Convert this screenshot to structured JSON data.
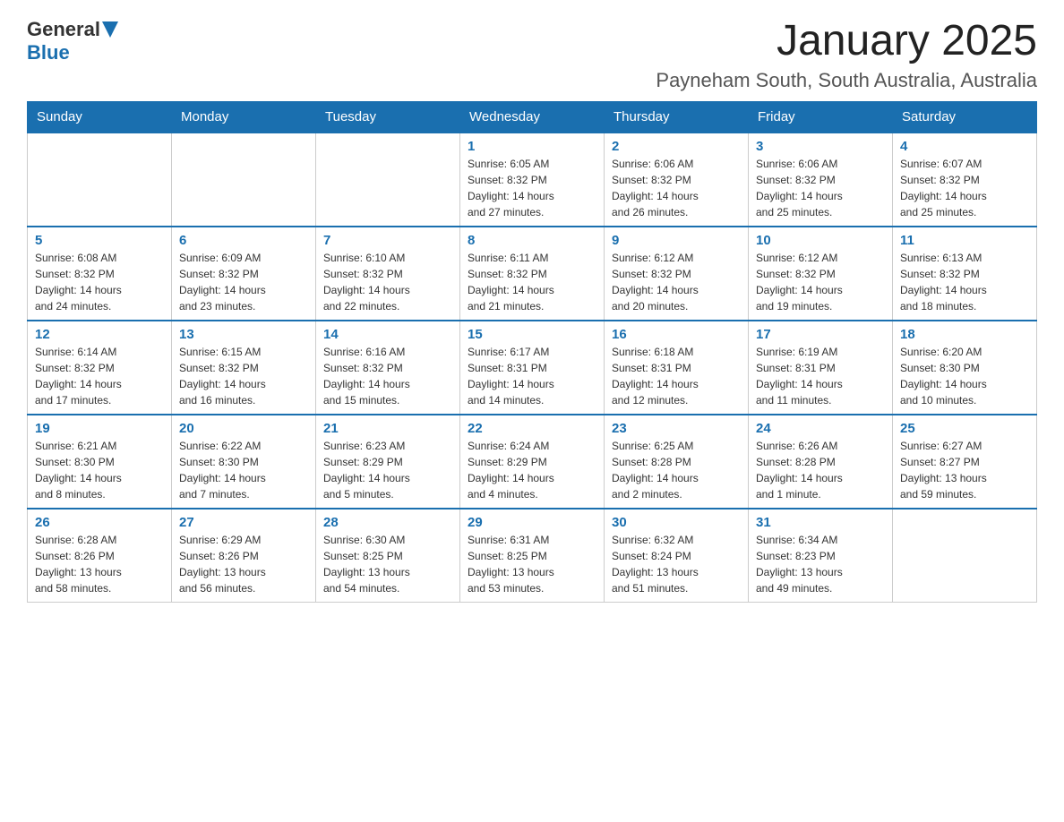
{
  "header": {
    "logo_general": "General",
    "logo_blue": "Blue",
    "title": "January 2025",
    "subtitle": "Payneham South, South Australia, Australia"
  },
  "days_of_week": [
    "Sunday",
    "Monday",
    "Tuesday",
    "Wednesday",
    "Thursday",
    "Friday",
    "Saturday"
  ],
  "weeks": [
    [
      {
        "day": "",
        "info": ""
      },
      {
        "day": "",
        "info": ""
      },
      {
        "day": "",
        "info": ""
      },
      {
        "day": "1",
        "info": "Sunrise: 6:05 AM\nSunset: 8:32 PM\nDaylight: 14 hours\nand 27 minutes."
      },
      {
        "day": "2",
        "info": "Sunrise: 6:06 AM\nSunset: 8:32 PM\nDaylight: 14 hours\nand 26 minutes."
      },
      {
        "day": "3",
        "info": "Sunrise: 6:06 AM\nSunset: 8:32 PM\nDaylight: 14 hours\nand 25 minutes."
      },
      {
        "day": "4",
        "info": "Sunrise: 6:07 AM\nSunset: 8:32 PM\nDaylight: 14 hours\nand 25 minutes."
      }
    ],
    [
      {
        "day": "5",
        "info": "Sunrise: 6:08 AM\nSunset: 8:32 PM\nDaylight: 14 hours\nand 24 minutes."
      },
      {
        "day": "6",
        "info": "Sunrise: 6:09 AM\nSunset: 8:32 PM\nDaylight: 14 hours\nand 23 minutes."
      },
      {
        "day": "7",
        "info": "Sunrise: 6:10 AM\nSunset: 8:32 PM\nDaylight: 14 hours\nand 22 minutes."
      },
      {
        "day": "8",
        "info": "Sunrise: 6:11 AM\nSunset: 8:32 PM\nDaylight: 14 hours\nand 21 minutes."
      },
      {
        "day": "9",
        "info": "Sunrise: 6:12 AM\nSunset: 8:32 PM\nDaylight: 14 hours\nand 20 minutes."
      },
      {
        "day": "10",
        "info": "Sunrise: 6:12 AM\nSunset: 8:32 PM\nDaylight: 14 hours\nand 19 minutes."
      },
      {
        "day": "11",
        "info": "Sunrise: 6:13 AM\nSunset: 8:32 PM\nDaylight: 14 hours\nand 18 minutes."
      }
    ],
    [
      {
        "day": "12",
        "info": "Sunrise: 6:14 AM\nSunset: 8:32 PM\nDaylight: 14 hours\nand 17 minutes."
      },
      {
        "day": "13",
        "info": "Sunrise: 6:15 AM\nSunset: 8:32 PM\nDaylight: 14 hours\nand 16 minutes."
      },
      {
        "day": "14",
        "info": "Sunrise: 6:16 AM\nSunset: 8:32 PM\nDaylight: 14 hours\nand 15 minutes."
      },
      {
        "day": "15",
        "info": "Sunrise: 6:17 AM\nSunset: 8:31 PM\nDaylight: 14 hours\nand 14 minutes."
      },
      {
        "day": "16",
        "info": "Sunrise: 6:18 AM\nSunset: 8:31 PM\nDaylight: 14 hours\nand 12 minutes."
      },
      {
        "day": "17",
        "info": "Sunrise: 6:19 AM\nSunset: 8:31 PM\nDaylight: 14 hours\nand 11 minutes."
      },
      {
        "day": "18",
        "info": "Sunrise: 6:20 AM\nSunset: 8:30 PM\nDaylight: 14 hours\nand 10 minutes."
      }
    ],
    [
      {
        "day": "19",
        "info": "Sunrise: 6:21 AM\nSunset: 8:30 PM\nDaylight: 14 hours\nand 8 minutes."
      },
      {
        "day": "20",
        "info": "Sunrise: 6:22 AM\nSunset: 8:30 PM\nDaylight: 14 hours\nand 7 minutes."
      },
      {
        "day": "21",
        "info": "Sunrise: 6:23 AM\nSunset: 8:29 PM\nDaylight: 14 hours\nand 5 minutes."
      },
      {
        "day": "22",
        "info": "Sunrise: 6:24 AM\nSunset: 8:29 PM\nDaylight: 14 hours\nand 4 minutes."
      },
      {
        "day": "23",
        "info": "Sunrise: 6:25 AM\nSunset: 8:28 PM\nDaylight: 14 hours\nand 2 minutes."
      },
      {
        "day": "24",
        "info": "Sunrise: 6:26 AM\nSunset: 8:28 PM\nDaylight: 14 hours\nand 1 minute."
      },
      {
        "day": "25",
        "info": "Sunrise: 6:27 AM\nSunset: 8:27 PM\nDaylight: 13 hours\nand 59 minutes."
      }
    ],
    [
      {
        "day": "26",
        "info": "Sunrise: 6:28 AM\nSunset: 8:26 PM\nDaylight: 13 hours\nand 58 minutes."
      },
      {
        "day": "27",
        "info": "Sunrise: 6:29 AM\nSunset: 8:26 PM\nDaylight: 13 hours\nand 56 minutes."
      },
      {
        "day": "28",
        "info": "Sunrise: 6:30 AM\nSunset: 8:25 PM\nDaylight: 13 hours\nand 54 minutes."
      },
      {
        "day": "29",
        "info": "Sunrise: 6:31 AM\nSunset: 8:25 PM\nDaylight: 13 hours\nand 53 minutes."
      },
      {
        "day": "30",
        "info": "Sunrise: 6:32 AM\nSunset: 8:24 PM\nDaylight: 13 hours\nand 51 minutes."
      },
      {
        "day": "31",
        "info": "Sunrise: 6:34 AM\nSunset: 8:23 PM\nDaylight: 13 hours\nand 49 minutes."
      },
      {
        "day": "",
        "info": ""
      }
    ]
  ]
}
